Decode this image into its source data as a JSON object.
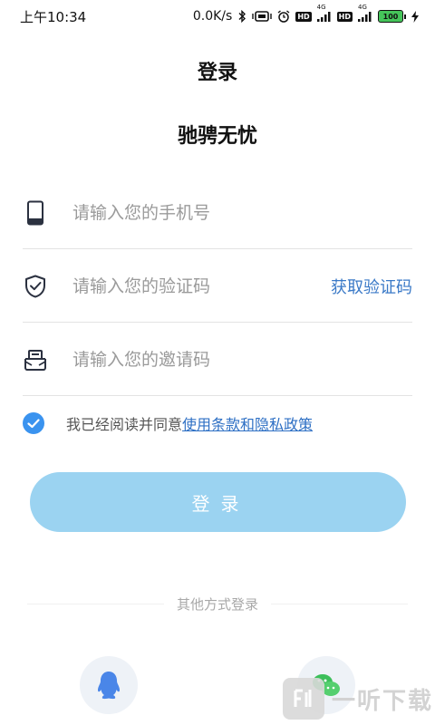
{
  "status_bar": {
    "time": "上午10:34",
    "network_speed": "0.0K/s",
    "sim1_tag": "HD",
    "sim1_net": "4G",
    "sim2_tag": "HD",
    "sim2_net": "4G",
    "battery": "100",
    "icons": [
      "bluetooth-icon",
      "vibrate-icon",
      "alarm-icon",
      "signal-icon",
      "signal-icon",
      "battery-icon",
      "charging-icon"
    ]
  },
  "header": {
    "title": "登录"
  },
  "app": {
    "name": "驰骋无忧"
  },
  "form": {
    "phone": {
      "icon": "phone-icon",
      "value": "",
      "placeholder": "请输入您的手机号"
    },
    "code": {
      "icon": "shield-check-icon",
      "value": "",
      "placeholder": "请输入您的验证码",
      "get_code_label": "获取验证码"
    },
    "invite": {
      "icon": "invite-card-icon",
      "value": "",
      "placeholder": "请输入您的邀请码"
    }
  },
  "agreement": {
    "checked": true,
    "text": "我已经阅读并同意",
    "link": "使用条款和隐私政策"
  },
  "login_button": {
    "label": "登录"
  },
  "other_login": {
    "label": "其他方式登录",
    "options": [
      "qq-icon",
      "wechat-icon"
    ]
  },
  "watermark": {
    "text": "一听下载"
  },
  "colors": {
    "accent": "#3a79c7",
    "button": "#9bd3f1",
    "check": "#3a93ef"
  }
}
